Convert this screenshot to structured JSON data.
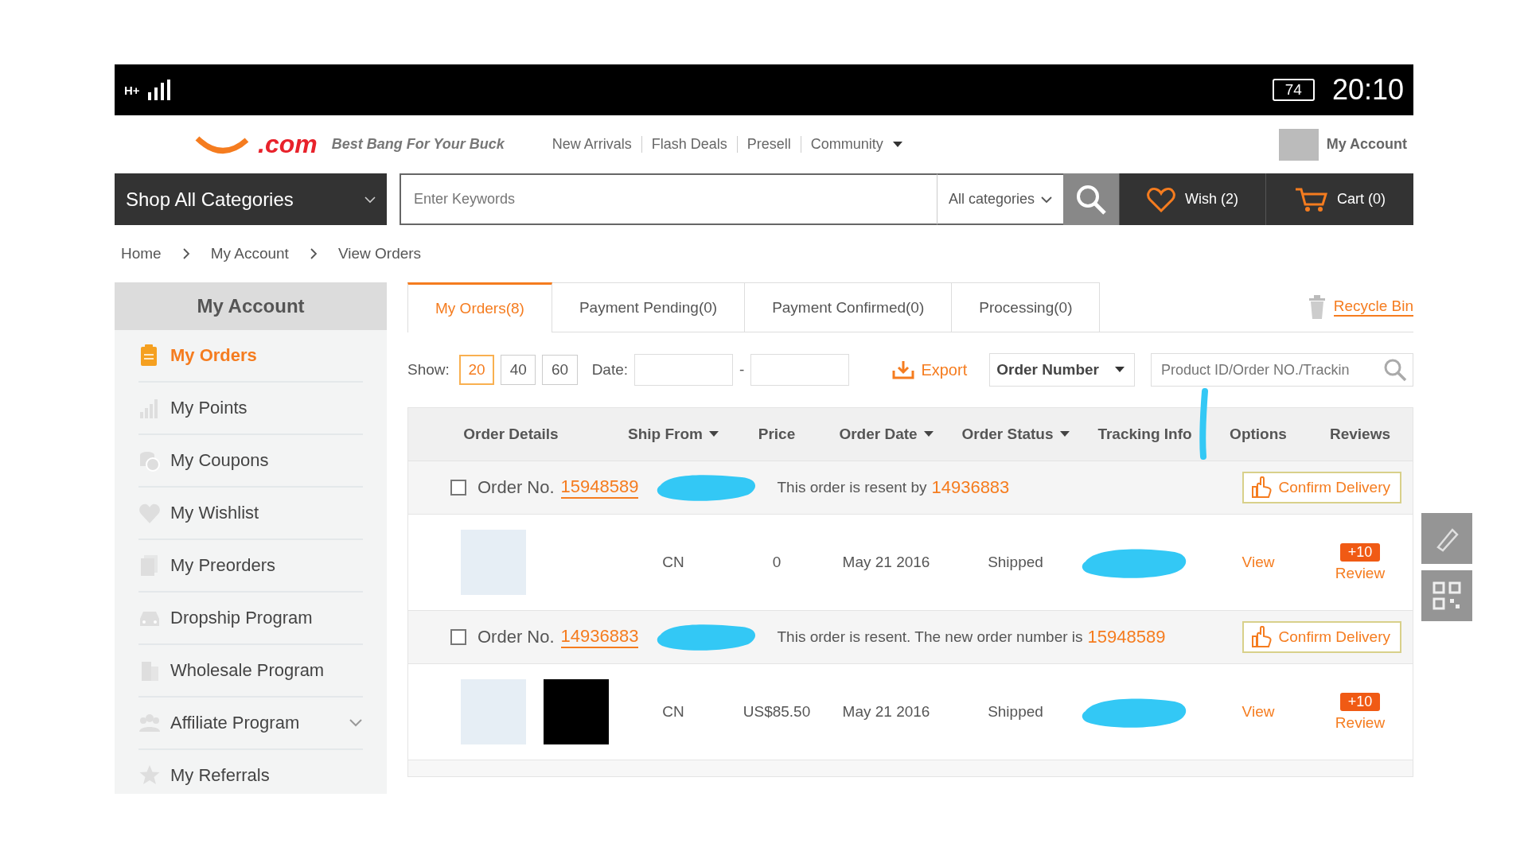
{
  "status_bar": {
    "network": "H+",
    "battery": "74",
    "time": "20:10"
  },
  "header": {
    "logo_text": ".com",
    "tagline": "Best Bang For Your Buck",
    "nav": [
      "New Arrivals",
      "Flash Deals",
      "Presell",
      "Community"
    ],
    "account": "My Account"
  },
  "search_bar": {
    "categories_button": "Shop All Categories",
    "placeholder": "Enter Keywords",
    "category_select": "All categories",
    "wish": "Wish (2)",
    "cart": "Cart (0)"
  },
  "breadcrumb": [
    "Home",
    "My Account",
    "View Orders"
  ],
  "sidebar": {
    "title": "My Account",
    "items": [
      {
        "label": "My Orders",
        "selected": true,
        "kind": "link"
      },
      {
        "label": "My Points",
        "selected": false,
        "kind": "link"
      },
      {
        "label": "My Coupons",
        "selected": false,
        "kind": "link"
      },
      {
        "label": "My Wishlist",
        "selected": false,
        "kind": "link"
      },
      {
        "label": "My Preorders",
        "selected": false,
        "kind": "link"
      },
      {
        "label": "Dropship Program",
        "selected": false,
        "kind": "link"
      },
      {
        "label": "Wholesale Program",
        "selected": false,
        "kind": "link"
      },
      {
        "label": "Affiliate Program",
        "selected": false,
        "kind": "group"
      },
      {
        "label": "My Referrals",
        "selected": false,
        "kind": "link"
      }
    ]
  },
  "tabs": [
    {
      "label": "My Orders(8)",
      "selected": true
    },
    {
      "label": "Payment Pending(0)",
      "selected": false
    },
    {
      "label": "Payment Confirmed(0)",
      "selected": false
    },
    {
      "label": "Processing(0)",
      "selected": false
    }
  ],
  "recycle_bin": "Recycle Bin",
  "filters": {
    "show_label": "Show:",
    "page_sizes": [
      {
        "label": "20",
        "selected": true
      },
      {
        "label": "40",
        "selected": false
      },
      {
        "label": "60",
        "selected": false
      }
    ],
    "date_label": "Date:",
    "date_separator": "-",
    "export": "Export",
    "sort_select": "Order Number",
    "search_placeholder": "Product ID/Order NO./Trackin"
  },
  "table": {
    "columns": [
      {
        "label": "Order Details",
        "sortable": false
      },
      {
        "label": "Ship From",
        "sortable": true
      },
      {
        "label": "Price",
        "sortable": false
      },
      {
        "label": "Order Date",
        "sortable": true
      },
      {
        "label": "Order Status",
        "sortable": true
      },
      {
        "label": "Tracking Info",
        "sortable": false
      },
      {
        "label": "Options",
        "sortable": false
      },
      {
        "label": "Reviews",
        "sortable": false
      }
    ],
    "orders": [
      {
        "order_label": "Order No.",
        "order_number": "15948589",
        "checked": false,
        "note": "This order is resent by",
        "note_number": "14936883",
        "action": "Confirm Delivery",
        "photos": [
          {
            "kind": "light"
          }
        ],
        "ship_from": "CN",
        "price": "0",
        "date": "May 21 2016",
        "status": "Shipped",
        "option": "View",
        "review_badge": "+10",
        "review": "Review"
      },
      {
        "order_label": "Order No.",
        "order_number": "14936883",
        "checked": false,
        "note": "This order is resent. The new order number is",
        "note_number": "15948589",
        "action": "Confirm Delivery",
        "photos": [
          {
            "kind": "light"
          },
          {
            "kind": "dark"
          }
        ],
        "ship_from": "CN",
        "price": "US$85.50",
        "date": "May 21 2016",
        "status": "Shipped",
        "option": "View",
        "review_badge": "+10",
        "review": "Review"
      }
    ]
  }
}
